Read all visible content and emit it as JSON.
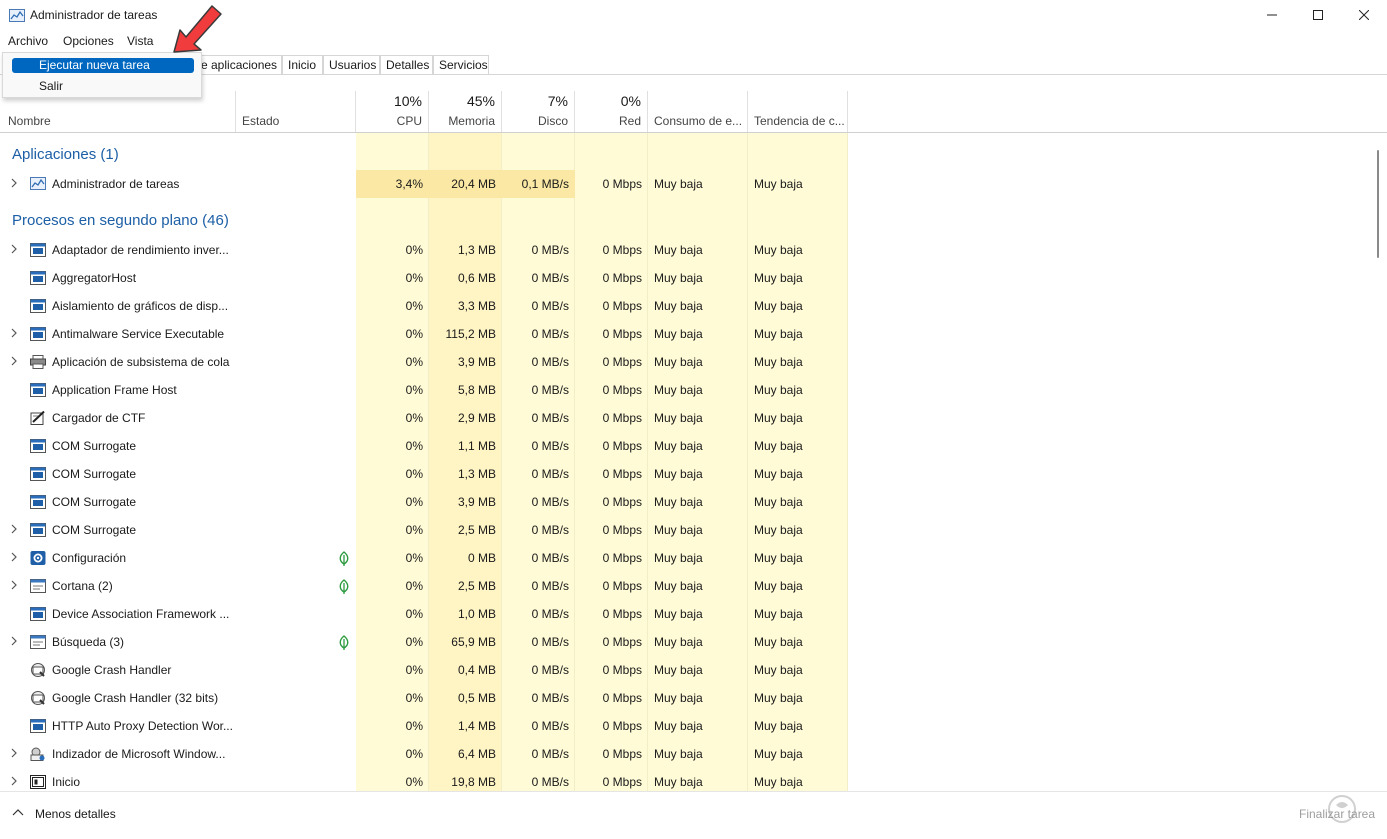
{
  "window": {
    "title": "Administrador de tareas",
    "controls": [
      "minimize",
      "maximize",
      "close"
    ]
  },
  "menu": {
    "items": [
      "Archivo",
      "Opciones",
      "Vista"
    ],
    "dropdown": [
      "Ejecutar nueva tarea",
      "Salir"
    ],
    "active_dropdown_index": 0
  },
  "tabs": [
    "e aplicaciones",
    "Inicio",
    "Usuarios",
    "Detalles",
    "Servicios"
  ],
  "columns": {
    "name": "Nombre",
    "status": "Estado",
    "cpu": {
      "pct": "10%",
      "label": "CPU"
    },
    "memory": {
      "pct": "45%",
      "label": "Memoria"
    },
    "disk": {
      "pct": "7%",
      "label": "Disco"
    },
    "network": {
      "pct": "0%",
      "label": "Red"
    },
    "power": "Consumo de e...",
    "power_trend": "Tendencia de c..."
  },
  "groups": {
    "apps": "Aplicaciones (1)",
    "background": "Procesos en segundo plano (46)"
  },
  "app_rows": [
    {
      "name": "Administrador de tareas",
      "icon": "task-manager-icon",
      "expandable": true,
      "cpu": "3,4%",
      "mem": "20,4 MB",
      "disk": "0,1 MB/s",
      "net": "0 Mbps",
      "power": "Muy baja",
      "trend": "Muy baja"
    }
  ],
  "bg_rows": [
    {
      "name": "Adaptador de rendimiento inver...",
      "icon": "service-icon",
      "expandable": true,
      "leaf": false,
      "cpu": "0%",
      "mem": "1,3 MB",
      "disk": "0 MB/s",
      "net": "0 Mbps",
      "power": "Muy baja",
      "trend": "Muy baja"
    },
    {
      "name": "AggregatorHost",
      "icon": "service-icon",
      "expandable": false,
      "leaf": false,
      "cpu": "0%",
      "mem": "0,6 MB",
      "disk": "0 MB/s",
      "net": "0 Mbps",
      "power": "Muy baja",
      "trend": "Muy baja"
    },
    {
      "name": "Aislamiento de gráficos de disp...",
      "icon": "service-icon",
      "expandable": false,
      "leaf": false,
      "cpu": "0%",
      "mem": "3,3 MB",
      "disk": "0 MB/s",
      "net": "0 Mbps",
      "power": "Muy baja",
      "trend": "Muy baja"
    },
    {
      "name": "Antimalware Service Executable",
      "icon": "service-icon",
      "expandable": true,
      "leaf": false,
      "cpu": "0%",
      "mem": "115,2 MB",
      "disk": "0 MB/s",
      "net": "0 Mbps",
      "power": "Muy baja",
      "trend": "Muy baja"
    },
    {
      "name": "Aplicación de subsistema de cola",
      "icon": "printer-icon",
      "expandable": true,
      "leaf": false,
      "cpu": "0%",
      "mem": "3,9 MB",
      "disk": "0 MB/s",
      "net": "0 Mbps",
      "power": "Muy baja",
      "trend": "Muy baja"
    },
    {
      "name": "Application Frame Host",
      "icon": "service-icon",
      "expandable": false,
      "leaf": false,
      "cpu": "0%",
      "mem": "5,8 MB",
      "disk": "0 MB/s",
      "net": "0 Mbps",
      "power": "Muy baja",
      "trend": "Muy baja"
    },
    {
      "name": "Cargador de CTF",
      "icon": "ctf-pen-icon",
      "expandable": false,
      "leaf": false,
      "cpu": "0%",
      "mem": "2,9 MB",
      "disk": "0 MB/s",
      "net": "0 Mbps",
      "power": "Muy baja",
      "trend": "Muy baja"
    },
    {
      "name": "COM Surrogate",
      "icon": "service-icon",
      "expandable": false,
      "leaf": false,
      "cpu": "0%",
      "mem": "1,1 MB",
      "disk": "0 MB/s",
      "net": "0 Mbps",
      "power": "Muy baja",
      "trend": "Muy baja"
    },
    {
      "name": "COM Surrogate",
      "icon": "service-icon",
      "expandable": false,
      "leaf": false,
      "cpu": "0%",
      "mem": "1,3 MB",
      "disk": "0 MB/s",
      "net": "0 Mbps",
      "power": "Muy baja",
      "trend": "Muy baja"
    },
    {
      "name": "COM Surrogate",
      "icon": "service-icon",
      "expandable": false,
      "leaf": false,
      "cpu": "0%",
      "mem": "3,9 MB",
      "disk": "0 MB/s",
      "net": "0 Mbps",
      "power": "Muy baja",
      "trend": "Muy baja"
    },
    {
      "name": "COM Surrogate",
      "icon": "service-icon",
      "expandable": true,
      "leaf": false,
      "cpu": "0%",
      "mem": "2,5 MB",
      "disk": "0 MB/s",
      "net": "0 Mbps",
      "power": "Muy baja",
      "trend": "Muy baja"
    },
    {
      "name": "Configuración",
      "icon": "settings-gear-icon",
      "expandable": true,
      "leaf": true,
      "cpu": "0%",
      "mem": "0 MB",
      "disk": "0 MB/s",
      "net": "0 Mbps",
      "power": "Muy baja",
      "trend": "Muy baja"
    },
    {
      "name": "Cortana (2)",
      "icon": "window-icon",
      "expandable": true,
      "leaf": true,
      "cpu": "0%",
      "mem": "2,5 MB",
      "disk": "0 MB/s",
      "net": "0 Mbps",
      "power": "Muy baja",
      "trend": "Muy baja"
    },
    {
      "name": "Device Association Framework ...",
      "icon": "service-icon",
      "expandable": false,
      "leaf": false,
      "cpu": "0%",
      "mem": "1,0 MB",
      "disk": "0 MB/s",
      "net": "0 Mbps",
      "power": "Muy baja",
      "trend": "Muy baja"
    },
    {
      "name": "Búsqueda (3)",
      "icon": "window-icon",
      "expandable": true,
      "leaf": true,
      "cpu": "0%",
      "mem": "65,9 MB",
      "disk": "0 MB/s",
      "net": "0 Mbps",
      "power": "Muy baja",
      "trend": "Muy baja"
    },
    {
      "name": "Google Crash Handler",
      "icon": "google-update-icon",
      "expandable": false,
      "leaf": false,
      "cpu": "0%",
      "mem": "0,4 MB",
      "disk": "0 MB/s",
      "net": "0 Mbps",
      "power": "Muy baja",
      "trend": "Muy baja"
    },
    {
      "name": "Google Crash Handler (32 bits)",
      "icon": "google-update-icon",
      "expandable": false,
      "leaf": false,
      "cpu": "0%",
      "mem": "0,5 MB",
      "disk": "0 MB/s",
      "net": "0 Mbps",
      "power": "Muy baja",
      "trend": "Muy baja"
    },
    {
      "name": "HTTP Auto Proxy Detection Wor...",
      "icon": "service-icon",
      "expandable": false,
      "leaf": false,
      "cpu": "0%",
      "mem": "1,4 MB",
      "disk": "0 MB/s",
      "net": "0 Mbps",
      "power": "Muy baja",
      "trend": "Muy baja"
    },
    {
      "name": "Indizador de Microsoft Window...",
      "icon": "search-indexer-icon",
      "expandable": true,
      "leaf": false,
      "cpu": "0%",
      "mem": "6,4 MB",
      "disk": "0 MB/s",
      "net": "0 Mbps",
      "power": "Muy baja",
      "trend": "Muy baja"
    },
    {
      "name": "Inicio",
      "icon": "start-window-icon",
      "expandable": true,
      "leaf": false,
      "cpu": "0%",
      "mem": "19,8 MB",
      "disk": "0 MB/s",
      "net": "0 Mbps",
      "power": "Muy baja",
      "trend": "Muy baja"
    }
  ],
  "footer": {
    "less_details": "Menos detalles",
    "end_task": "Finalizar tarea"
  },
  "colors": {
    "accent": "#0067c0",
    "group_title": "#1c5fa6",
    "cell_bg": "#fffbd6",
    "cell_bg_mem": "#fff4c4",
    "app_row_highlight": "#fbe8a4",
    "arrow": "#f03c3c"
  }
}
